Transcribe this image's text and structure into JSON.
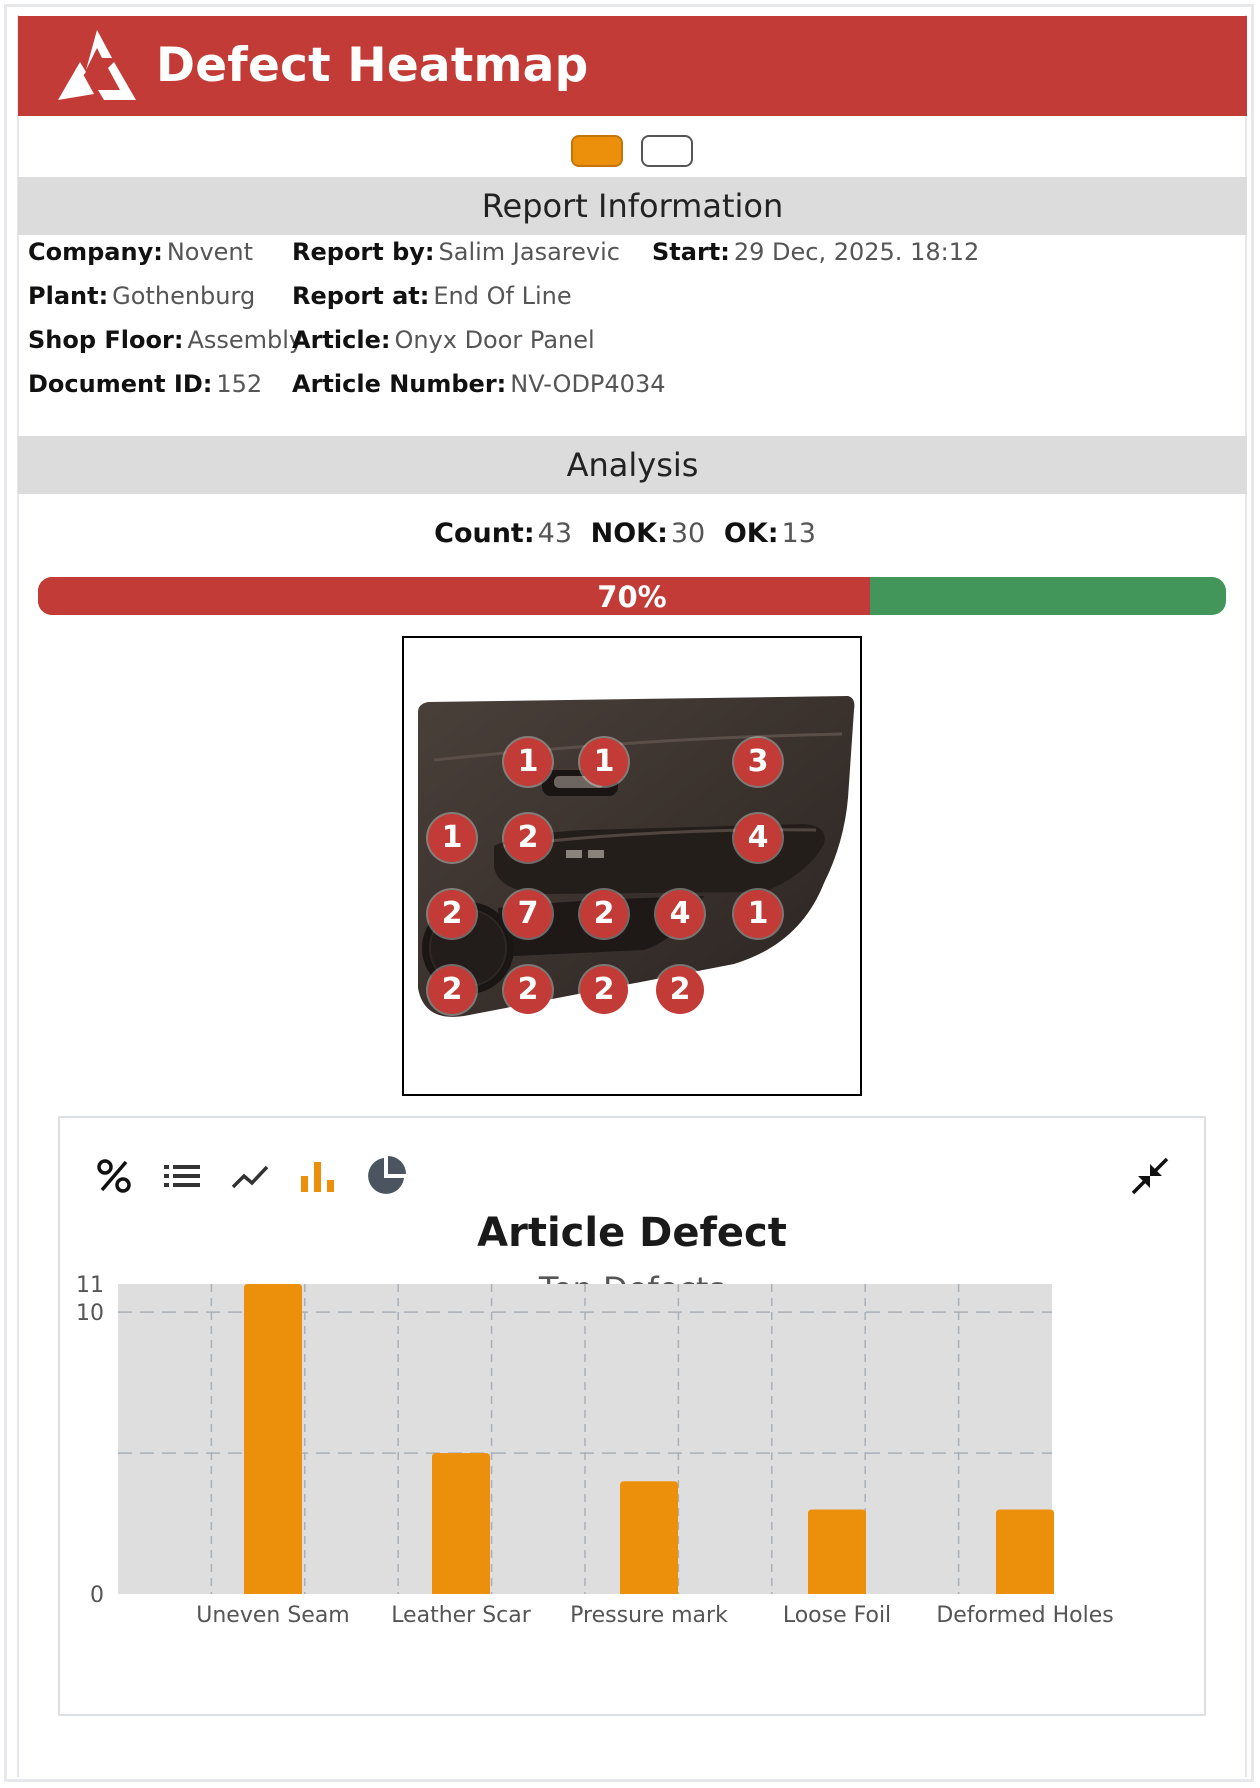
{
  "header": {
    "title": "Defect Heatmap"
  },
  "report_info": {
    "title": "Report Information",
    "company": {
      "label": "Company:",
      "value": "Novent"
    },
    "plant": {
      "label": "Plant:",
      "value": "Gothenburg"
    },
    "shop_floor": {
      "label": "Shop Floor:",
      "value": "Assembly"
    },
    "document_id": {
      "label": "Document ID:",
      "value": "152"
    },
    "report_by": {
      "label": "Report by:",
      "value": "Salim Jasarevic"
    },
    "report_at": {
      "label": "Report at:",
      "value": "End Of Line"
    },
    "article": {
      "label": "Article:",
      "value": "Onyx Door Panel"
    },
    "article_number": {
      "label": "Article Number:",
      "value": "NV-ODP4034"
    },
    "start": {
      "label": "Start:",
      "value": "29 Dec, 2025. 18:12"
    }
  },
  "analysis": {
    "title": "Analysis",
    "count": {
      "label": "Count:",
      "value": "43"
    },
    "nok": {
      "label": "NOK:",
      "value": "30"
    },
    "ok": {
      "label": "OK:",
      "value": "13"
    },
    "nok_ratio": 0.7,
    "nok_percent_label": "70%"
  },
  "colors": {
    "brand": "#c33b36",
    "accent": "#ec8f0b",
    "ok": "#43965a",
    "marker": "#c33b36"
  },
  "heatmap": {
    "markers": [
      "1",
      "1",
      "3",
      "1",
      "2",
      "4",
      "2",
      "7",
      "2",
      "4",
      "1",
      "2",
      "2",
      "2",
      "2"
    ]
  },
  "toolbar": {
    "icons": [
      "percent-icon",
      "list-icon",
      "line-chart-icon",
      "bar-chart-icon",
      "pie-chart-icon",
      "collapse-icon"
    ],
    "active": "bar-chart-icon"
  },
  "chart_data": {
    "type": "bar",
    "title": "Article Defect",
    "subtitle": "Top Defects",
    "categories": [
      "Uneven Seam",
      "Leather Scar",
      "Pressure mark",
      "Loose Foil",
      "Deformed Holes"
    ],
    "values": [
      11,
      5,
      4,
      3,
      3
    ],
    "ylim": [
      0,
      11
    ],
    "yticks": [
      "0",
      "10",
      "11"
    ],
    "grid": true,
    "color": "#ec8f0b"
  }
}
